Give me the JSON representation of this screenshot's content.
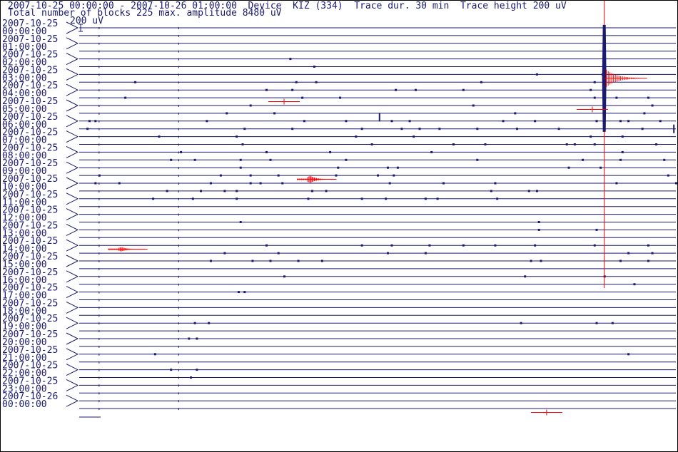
{
  "header": {
    "line1": "2007-10-25 00:00:00 - 2007-10-26 01:00:00  Device  KIZ (334)  Trace dur. 30 min  Trace height 200 uV",
    "line2": "Total number of blocks 225 max. amplitude 8480 uV"
  },
  "scale_label": "200 uV",
  "colors": {
    "trace": "#1a1a6e",
    "event": "#ff0000",
    "background": "#ffffff"
  },
  "chart_data": {
    "type": "line",
    "title": "",
    "trace_duration_min": 30,
    "trace_height_uV": 200,
    "max_amplitude_uV": 8480,
    "total_blocks": 225,
    "row_labels": [
      [
        "2007-10-25",
        "00:00:00"
      ],
      [
        "2007-10-25",
        "01:00:00"
      ],
      [
        "2007-10-25",
        "02:00:00"
      ],
      [
        "2007-10-25",
        "03:00:00"
      ],
      [
        "2007-10-25",
        "04:00:00"
      ],
      [
        "2007-10-25",
        "05:00:00"
      ],
      [
        "2007-10-25",
        "06:00:00"
      ],
      [
        "2007-10-25",
        "07:00:00"
      ],
      [
        "2007-10-25",
        "08:00:00"
      ],
      [
        "2007-10-25",
        "09:00:00"
      ],
      [
        "2007-10-25",
        "10:00:00"
      ],
      [
        "2007-10-25",
        "11:00:00"
      ],
      [
        "2007-10-25",
        "12:00:00"
      ],
      [
        "2007-10-25",
        "13:00:00"
      ],
      [
        "2007-10-25",
        "14:00:00"
      ],
      [
        "2007-10-25",
        "15:00:00"
      ],
      [
        "2007-10-25",
        "16:00:00"
      ],
      [
        "2007-10-25",
        "17:00:00"
      ],
      [
        "2007-10-25",
        "18:00:00"
      ],
      [
        "2007-10-25",
        "19:00:00"
      ],
      [
        "2007-10-25",
        "20:00:00"
      ],
      [
        "2007-10-25",
        "21:00:00"
      ],
      [
        "2007-10-25",
        "22:00:00"
      ],
      [
        "2007-10-25",
        "23:00:00"
      ],
      [
        "2007-10-26",
        "00:00:00"
      ]
    ],
    "events": [
      {
        "trace": 6.5,
        "minute": 26.4,
        "amplitude_uV": 8480,
        "color": "red"
      },
      {
        "trace": 19.5,
        "minute": 11.5,
        "amplitude_uV": 180,
        "color": "red"
      },
      {
        "trace": 28.5,
        "minute": 2.0,
        "amplitude_uV": 110,
        "color": "red"
      },
      {
        "trace": 9.5,
        "minute": 10.3,
        "amplitude_uV": 20,
        "color": "red"
      },
      {
        "trace": 10.5,
        "minute": 25.8,
        "amplitude_uV": 20,
        "color": "red"
      },
      {
        "trace": 49.5,
        "minute": 23.5,
        "amplitude_uV": 30,
        "color": "red"
      }
    ],
    "blips": [
      [
        4,
        10.6
      ],
      [
        5,
        11.8
      ],
      [
        6,
        23.0
      ],
      [
        6,
        26.3
      ],
      [
        7,
        11.9
      ],
      [
        7,
        25.9
      ],
      [
        7,
        2.8
      ],
      [
        7,
        10.9
      ],
      [
        7,
        20.2
      ],
      [
        8,
        9.4
      ],
      [
        8,
        10.7
      ],
      [
        8,
        15.9
      ],
      [
        8,
        16.9
      ],
      [
        8,
        19.3
      ],
      [
        8,
        25.7
      ],
      [
        9,
        2.3
      ],
      [
        9,
        11.2
      ],
      [
        9,
        13.1
      ],
      [
        9,
        25.9
      ],
      [
        9,
        27.0
      ],
      [
        9,
        28.6
      ],
      [
        10,
        8.6
      ],
      [
        10,
        19.8
      ],
      [
        10,
        28.8
      ],
      [
        11,
        7.4
      ],
      [
        11,
        9.8
      ],
      [
        11,
        21.9
      ],
      [
        11,
        28.4
      ],
      [
        12,
        0.5
      ],
      [
        12,
        6.4
      ],
      [
        12,
        13.4
      ],
      [
        12,
        21.3
      ],
      [
        12,
        27.6
      ],
      [
        12,
        0.8
      ],
      [
        12,
        11.3
      ],
      [
        12,
        15.7
      ],
      [
        12,
        16.6
      ],
      [
        12,
        22.9
      ],
      [
        12,
        26.0
      ],
      [
        12,
        27.2
      ],
      [
        12,
        29.2
      ],
      [
        13,
        0.4
      ],
      [
        13,
        8.3
      ],
      [
        13,
        10.7
      ],
      [
        13,
        14.2
      ],
      [
        13,
        16.2
      ],
      [
        13,
        17.1
      ],
      [
        13,
        18.1
      ],
      [
        13,
        20.0
      ],
      [
        13,
        22.0
      ],
      [
        13,
        24.1
      ],
      [
        13,
        28.3
      ],
      [
        14,
        4.0
      ],
      [
        14,
        7.9
      ],
      [
        14,
        13.9
      ],
      [
        14,
        16.8
      ],
      [
        14,
        25.7
      ],
      [
        14,
        27.3
      ],
      [
        15,
        8.2
      ],
      [
        15,
        14.7
      ],
      [
        15,
        18.8
      ],
      [
        15,
        20.4
      ],
      [
        15,
        24.5
      ],
      [
        15,
        24.9
      ],
      [
        15,
        25.9
      ],
      [
        15,
        29.0
      ],
      [
        16,
        5.1
      ],
      [
        16,
        9.4
      ],
      [
        16,
        12.6
      ],
      [
        16,
        17.7
      ],
      [
        16,
        27.3
      ],
      [
        17,
        4.6
      ],
      [
        17,
        5.8
      ],
      [
        17,
        8.1
      ],
      [
        17,
        9.6
      ],
      [
        17,
        13.4
      ],
      [
        17,
        20.0
      ],
      [
        17,
        25.3
      ],
      [
        17,
        27.2
      ],
      [
        17,
        29.4
      ],
      [
        18,
        8.1
      ],
      [
        18,
        13.0
      ],
      [
        18,
        15.5
      ],
      [
        18,
        16.0
      ],
      [
        18,
        24.6
      ],
      [
        18,
        26.2
      ],
      [
        19,
        1.0
      ],
      [
        19,
        7.1
      ],
      [
        19,
        8.6
      ],
      [
        19,
        10.0
      ],
      [
        19,
        12.9
      ],
      [
        19,
        15.0
      ],
      [
        19,
        15.8
      ],
      [
        19,
        29.6
      ],
      [
        20,
        0.8
      ],
      [
        20,
        2.0
      ],
      [
        20,
        6.6
      ],
      [
        20,
        8.6
      ],
      [
        20,
        9.1
      ],
      [
        20,
        10.2
      ],
      [
        20,
        15.6
      ],
      [
        20,
        18.3
      ],
      [
        20,
        20.9
      ],
      [
        20,
        27.0
      ],
      [
        20,
        30.0
      ],
      [
        21,
        4.4
      ],
      [
        21,
        6.1
      ],
      [
        21,
        7.3
      ],
      [
        21,
        7.9
      ],
      [
        21,
        11.7
      ],
      [
        21,
        12.4
      ],
      [
        21,
        20.7
      ],
      [
        21,
        22.6
      ],
      [
        21,
        23.0
      ],
      [
        22,
        3.7
      ],
      [
        22,
        5.7
      ],
      [
        22,
        7.9
      ],
      [
        22,
        11.5
      ],
      [
        22,
        14.2
      ],
      [
        22,
        15.4
      ],
      [
        22,
        17.4
      ],
      [
        22,
        18.0
      ],
      [
        22,
        21.0
      ],
      [
        25,
        8.1
      ],
      [
        25,
        23.1
      ],
      [
        26,
        23.1
      ],
      [
        26,
        26.0
      ],
      [
        28,
        9.4
      ],
      [
        28,
        14.2
      ],
      [
        28,
        15.7
      ],
      [
        28,
        17.6
      ],
      [
        28,
        19.3
      ],
      [
        28,
        20.9
      ],
      [
        28,
        22.9
      ],
      [
        28,
        25.9
      ],
      [
        28,
        28.6
      ],
      [
        29,
        7.3
      ],
      [
        29,
        10.0
      ],
      [
        29,
        15.5
      ],
      [
        29,
        17.4
      ],
      [
        29,
        27.6
      ],
      [
        29,
        28.8
      ],
      [
        30,
        6.6
      ],
      [
        30,
        8.7
      ],
      [
        30,
        9.6
      ],
      [
        30,
        11.0
      ],
      [
        30,
        12.2
      ],
      [
        30,
        22.7
      ],
      [
        30,
        23.2
      ],
      [
        30,
        27.2
      ],
      [
        30,
        28.6
      ],
      [
        32,
        10.3
      ],
      [
        32,
        22.4
      ],
      [
        32,
        26.4
      ],
      [
        33,
        27.9
      ],
      [
        34,
        8.0
      ],
      [
        34,
        8.3
      ],
      [
        38,
        5.8
      ],
      [
        38,
        6.5
      ],
      [
        38,
        22.2
      ],
      [
        38,
        26.0
      ],
      [
        38,
        26.8
      ],
      [
        40,
        5.5
      ],
      [
        40,
        5.9
      ],
      [
        42,
        3.8
      ],
      [
        42,
        27.6
      ],
      [
        44,
        4.6
      ],
      [
        44,
        5.9
      ],
      [
        45,
        5.6
      ]
    ]
  }
}
